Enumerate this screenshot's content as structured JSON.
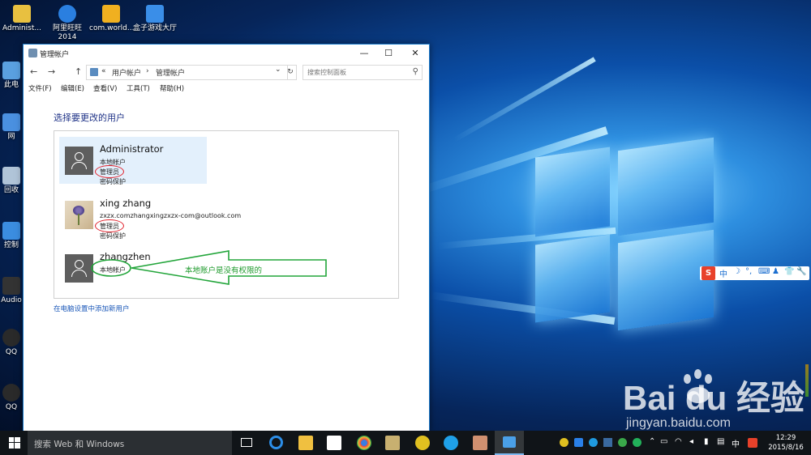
{
  "desktop": {
    "icons": [
      {
        "label": "Administ...",
        "color": "#e8c040"
      },
      {
        "label": "阿里旺旺 2014",
        "color": "#2a7fe0"
      },
      {
        "label": "com.world...",
        "color": "#f0b020"
      },
      {
        "label": "盒子游戏大厅",
        "color": "#3a8ee8"
      },
      {
        "label": "此电",
        "color": "#5aa0e0"
      },
      {
        "label": "网",
        "color": "#4a90e0"
      },
      {
        "label": "回收",
        "color": "#b0c4d8"
      },
      {
        "label": "控制",
        "color": "#3b8de0"
      },
      {
        "label": "Audio",
        "color": "#333333"
      },
      {
        "label": "QQ",
        "color": "#2a2a2a"
      },
      {
        "label": "QQ",
        "color": "#2a2a2a"
      }
    ]
  },
  "window": {
    "title": "管理帐户",
    "buttons": {
      "minimize": "—",
      "maximize": "☐",
      "close": "✕"
    },
    "nav": {
      "back": "←",
      "forward": "→",
      "up": "↑"
    },
    "address": {
      "sep": "«",
      "crumb1": "用户帐户",
      "arrow": "›",
      "crumb2": "管理帐户",
      "dropdown": "⌄",
      "refresh": "↻"
    },
    "search_placeholder": "搜索控制面板",
    "menus": [
      "文件(F)",
      "编辑(E)",
      "查看(V)",
      "工具(T)",
      "帮助(H)"
    ],
    "heading": "选择要更改的用户",
    "accounts": [
      {
        "name": "Administrator",
        "lines": [
          "本地帐户",
          "管理员",
          "密码保护"
        ]
      },
      {
        "name": "xing zhang",
        "lines": [
          "zxzx.comzhangxingzxzx-com@outlook.com",
          "管理员",
          "密码保护"
        ]
      },
      {
        "name": "zhangzhen",
        "lines": [
          "本地帐户"
        ]
      }
    ],
    "add_user_link": "在电脑设置中添加新用户"
  },
  "annotation": {
    "text": "本地账户是没有权限的",
    "color": "#1e9a2c"
  },
  "ime_bar": {
    "logo": "S",
    "items": [
      "中",
      "☽",
      "°,",
      "⌨",
      "♟",
      "👕",
      "🔧"
    ]
  },
  "watermark": {
    "brand": "Bai du 经验",
    "url": "jingyan.baidu.com"
  },
  "taskbar": {
    "search_placeholder": "搜索 Web 和 Windows",
    "tray_lang": "中",
    "time": "12:29",
    "date": "2015/8/16"
  }
}
